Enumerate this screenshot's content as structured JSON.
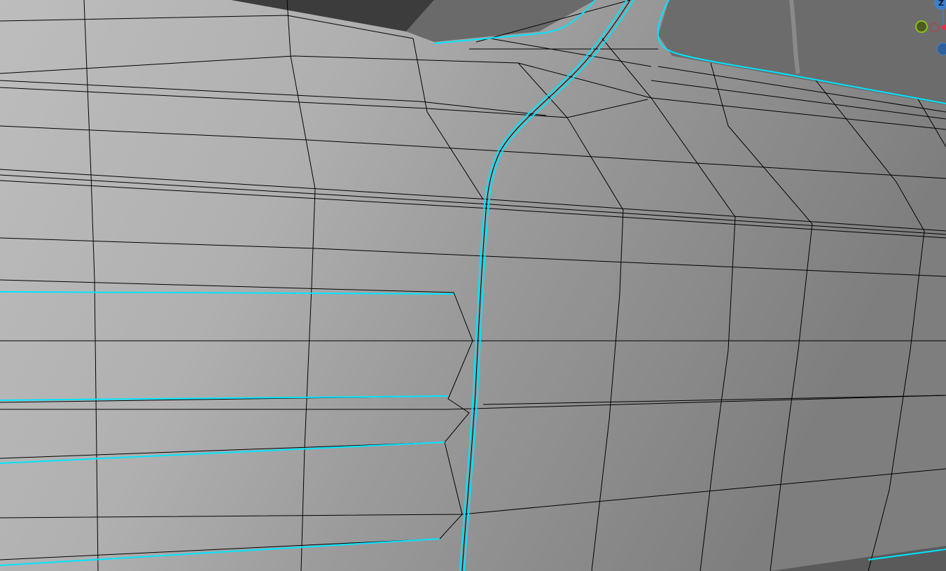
{
  "viewport": {
    "type": "3d-modeling-viewport",
    "background_color": "#6f6f6f",
    "surface_light": "#c4c4c4",
    "surface_dark": "#828282",
    "wire_color": "#000000",
    "selection_color": "#00e5ff"
  },
  "gizmo": {
    "z_label": "Z",
    "z_color": "#3d7fc9",
    "y_color": "#8cc21a",
    "x_color": "#e0354f"
  }
}
